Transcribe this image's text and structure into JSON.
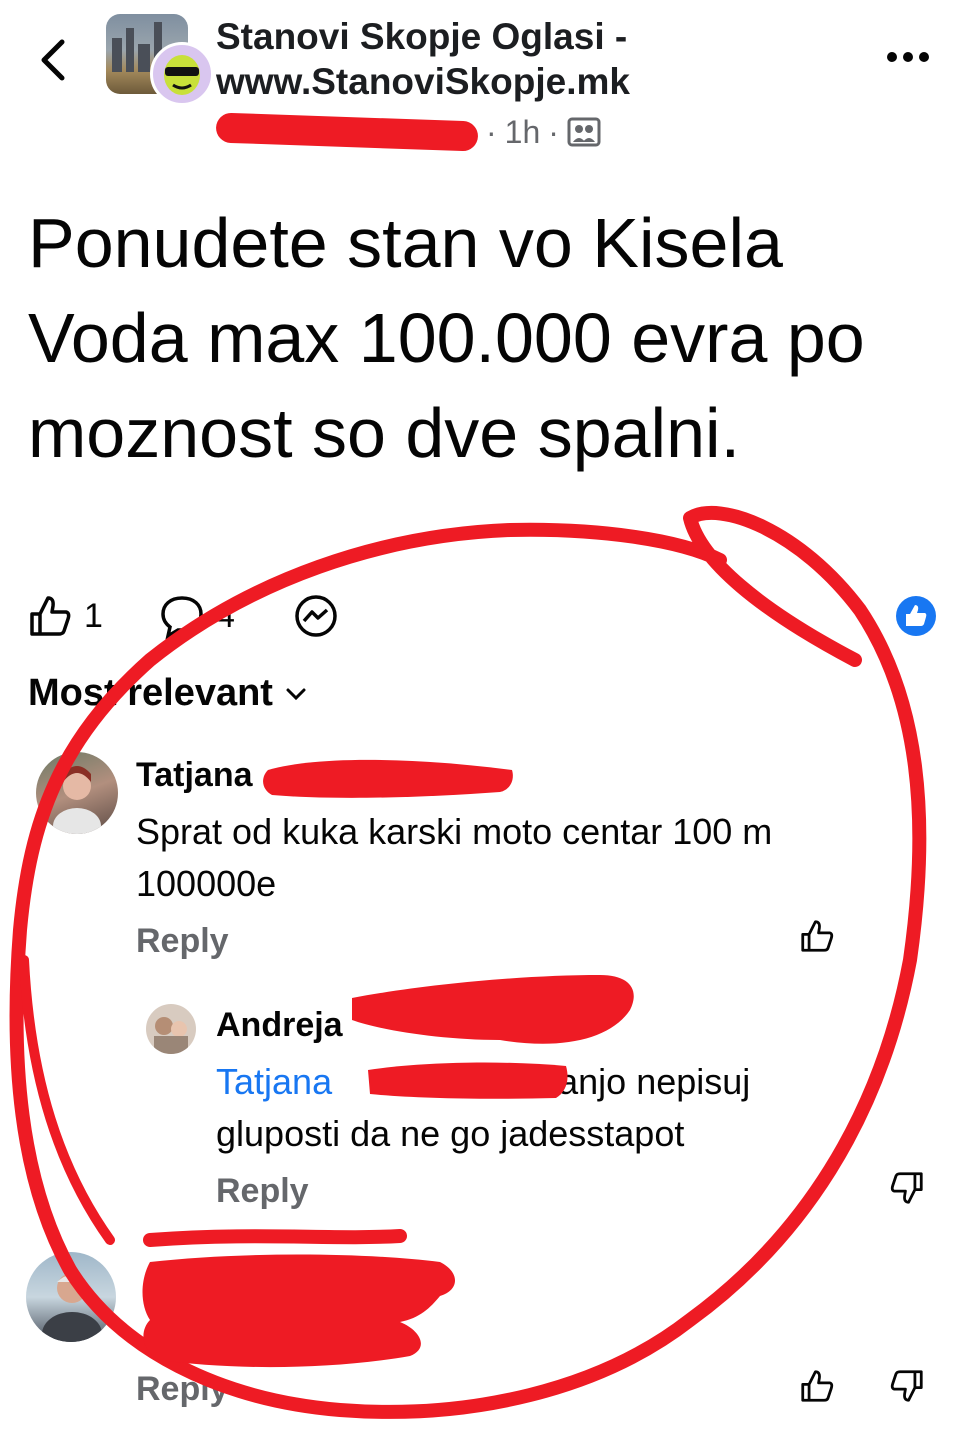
{
  "header": {
    "back_icon": "chevron-left-icon",
    "group_name": "Stanovi Skopje Oglasi - www.StanoviSkopje.mk",
    "time": "1h",
    "separator": "·",
    "audience_icon": "group-members-icon",
    "more_icon": "more-horizontal-icon"
  },
  "post": {
    "text": "Ponudete stan vo Kisela Voda max 100.000 evra po moznost so dve spalni."
  },
  "actions": {
    "like_count": "1",
    "comment_count": "4",
    "like_icon": "thumbs-up-icon",
    "comment_icon": "comment-bubble-icon",
    "messenger_icon": "messenger-icon",
    "reaction_icon": "like-reaction-icon"
  },
  "comments_sort": {
    "label": "Most relevant",
    "icon": "chevron-down-icon"
  },
  "comments": [
    {
      "author_first": "Tatjana",
      "text_line1": "Sprat od kuka karski moto centar 100 m",
      "text_line2": "100000e",
      "reply_label": "Reply"
    },
    {
      "author_first": "Andreja",
      "mention": "Tatjana",
      "text_line1": "tanjo nepisuj",
      "text_line2": "gluposti da ne go jadesstapot",
      "reply_label": "Reply"
    },
    {
      "reply_label": "Reply"
    }
  ],
  "colors": {
    "annotation_red": "#ee1b24",
    "facebook_blue": "#1877f2",
    "secondary_text": "#65676b"
  }
}
